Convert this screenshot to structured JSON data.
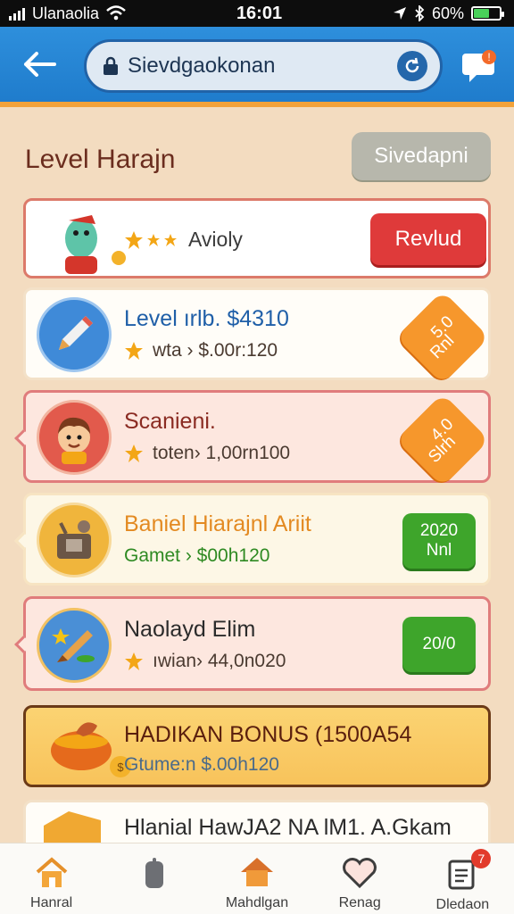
{
  "status_bar": {
    "carrier": "Ulanaolia",
    "time": "16:01",
    "battery": "60%",
    "battery_level": 0.6
  },
  "header": {
    "url": "Sievdgaokonan",
    "chat_badge": "!"
  },
  "page": {
    "title": "Level Harajn",
    "title_button": "Sivedapni"
  },
  "cards": [
    {
      "title": "",
      "sub": "Avioly",
      "action": "Revlud"
    },
    {
      "title": "Level ırlb. $4310",
      "sub": "wta ›  $.00r:120",
      "badge_top": "5.0",
      "badge_bottom": "Rnl"
    },
    {
      "title": "Scanieni.",
      "sub": "toten›  1,00rn100",
      "badge_top": "4.0",
      "badge_bottom": "Slrh"
    },
    {
      "title": "Baniel Hiarajnl  Ariit",
      "sub": "Gamet ›  $00h120",
      "badge_top": "2020",
      "badge_bottom": "Nnl"
    },
    {
      "title": "Naolayd Elim",
      "sub": "ıwian›  44,0n020",
      "badge_top": "20/0",
      "badge_bottom": ""
    },
    {
      "title": "HADIKAN BONUS  (1500A54",
      "sub": "Gtume:n  $.00h120"
    },
    {
      "title": "Hlanial HawJA2 NA lM1. A.Gkam"
    }
  ],
  "nav": [
    {
      "label": "Hanral",
      "icon": "home-icon"
    },
    {
      "label": "",
      "icon": "phone-icon"
    },
    {
      "label": "Mahdlgan",
      "icon": "house-icon"
    },
    {
      "label": "Renag",
      "icon": "heart-icon"
    },
    {
      "label": "Dledaon",
      "icon": "notes-icon",
      "badge": "7"
    }
  ],
  "colors": {
    "header": "#1f7ccc",
    "accent": "#f2a23a",
    "revive": "#df3a3a",
    "green": "#3ea52b",
    "orange": "#f6972c"
  }
}
